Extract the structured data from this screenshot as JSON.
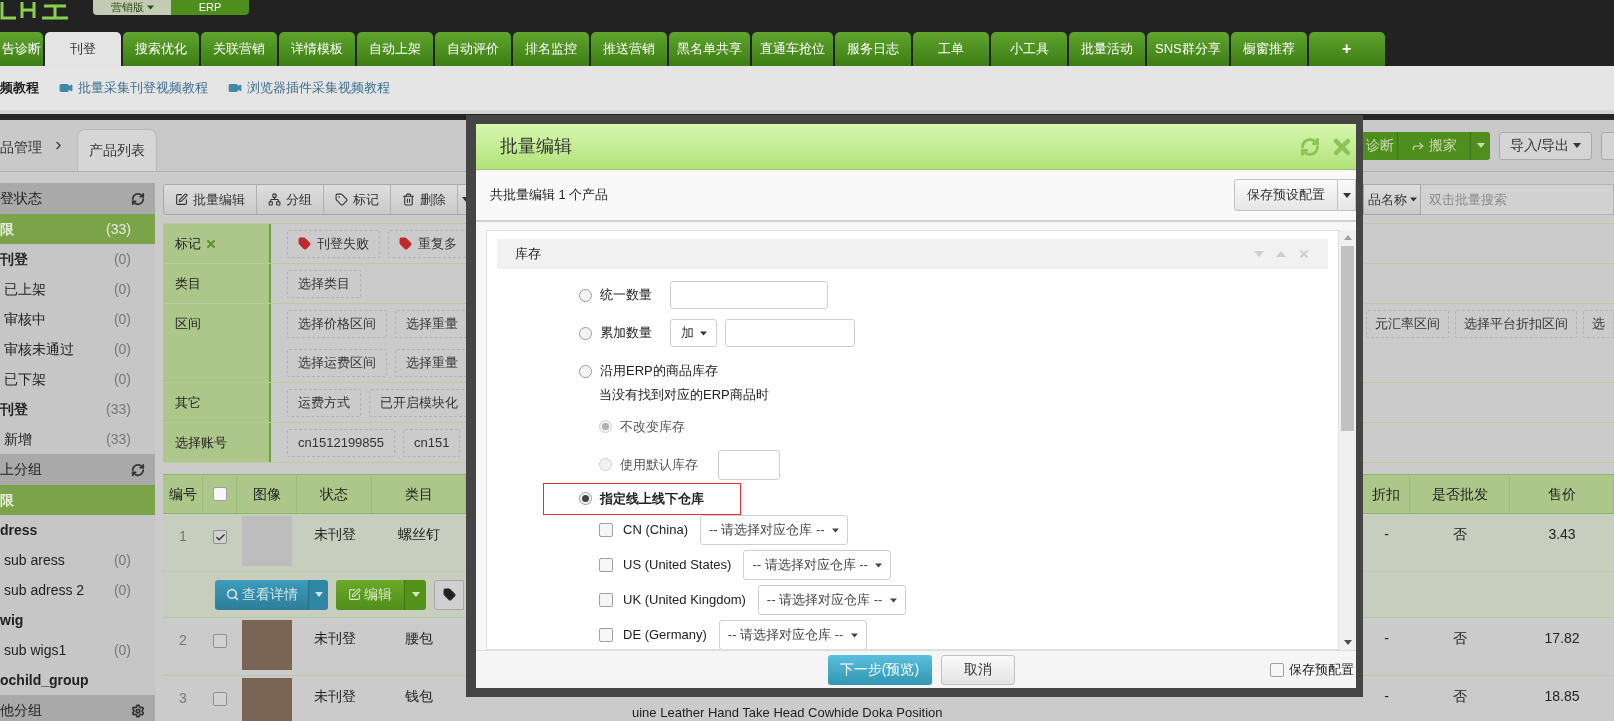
{
  "edition_switch": [
    {
      "label": "营销版",
      "selected": true
    },
    {
      "label": "ERP",
      "selected": false
    }
  ],
  "nav_tabs": [
    {
      "label": "告诊断",
      "selected": false
    },
    {
      "label": "刊登",
      "selected": true
    },
    {
      "label": "搜索优化",
      "selected": false
    },
    {
      "label": "关联营销",
      "selected": false
    },
    {
      "label": "详情模板",
      "selected": false
    },
    {
      "label": "自动上架",
      "selected": false
    },
    {
      "label": "自动评价",
      "selected": false
    },
    {
      "label": "排名监控",
      "selected": false
    },
    {
      "label": "推送营销",
      "selected": false
    },
    {
      "label": "黑名单共享",
      "selected": false
    },
    {
      "label": "直通车抢位",
      "selected": false
    },
    {
      "label": "服务日志",
      "selected": false
    },
    {
      "label": "工单",
      "selected": false
    },
    {
      "label": "小工具",
      "selected": false
    },
    {
      "label": "批量活动",
      "selected": false
    },
    {
      "label": "SNS群分享",
      "selected": false
    },
    {
      "label": "橱窗推荐",
      "selected": false
    },
    {
      "label": "+",
      "selected": false
    }
  ],
  "tutorials": [
    {
      "kind": "title",
      "label": "频教程"
    },
    {
      "kind": "video",
      "label": "批量采集刊登视频教程"
    },
    {
      "kind": "video",
      "label": "浏览器插件采集视频教程"
    }
  ],
  "breadcrumb": {
    "parent": "品管理",
    "current": "产品列表"
  },
  "top_actions": [
    {
      "kind": "partial",
      "label": "诊断"
    },
    {
      "kind": "split",
      "label": "搬家"
    },
    {
      "kind": "dropdown",
      "label": "导入/导出"
    },
    {
      "kind": "edge"
    }
  ],
  "toolbar": [
    {
      "kind": "edit",
      "label": "批量编辑"
    },
    {
      "kind": "group",
      "label": "分组"
    },
    {
      "kind": "tag",
      "label": "标记"
    },
    {
      "kind": "delete",
      "label": "删除"
    },
    {
      "kind": "more"
    }
  ],
  "search": {
    "field": "品名称",
    "placeholder": "双击批量搜索"
  },
  "sidebar": [
    {
      "title": "登状态",
      "kind": "refresh",
      "items": [
        {
          "label": "限",
          "count": "(33)",
          "selected": true
        },
        {
          "label": "刊登",
          "count": "(0)",
          "selected": false,
          "children": [
            {
              "label": "已上架",
              "count": "(0)",
              "selected": false
            },
            {
              "label": "审核中",
              "count": "(0)",
              "selected": false
            },
            {
              "label": "审核未通过",
              "count": "(0)",
              "selected": false
            },
            {
              "label": "已下架",
              "count": "(0)",
              "selected": false
            }
          ]
        },
        {
          "label": "刊登",
          "count": "(33)",
          "selected": false,
          "children": [
            {
              "label": "新增",
              "count": "(33)",
              "selected": false
            }
          ]
        }
      ]
    },
    {
      "title": "上分组",
      "kind": "refresh",
      "items": [
        {
          "label": "限",
          "selected": true
        },
        {
          "label": "dress",
          "selected": false,
          "children": [
            {
              "label": "sub aress",
              "count": "(0)",
              "selected": false
            },
            {
              "label": "sub adress 2",
              "count": "(0)",
              "selected": false
            }
          ]
        },
        {
          "label": "wig",
          "selected": false,
          "children": [
            {
              "label": "sub wigs1",
              "count": "(0)",
              "selected": false
            }
          ]
        },
        {
          "label": "ochild_group",
          "selected": false
        }
      ]
    },
    {
      "title": "他分组",
      "kind": "settings"
    }
  ],
  "filters": [
    {
      "label": "标记",
      "removable": true,
      "lines": [
        {
          "left": [
            {
              "kind": "tag",
              "label": "刊登失败"
            },
            {
              "kind": "tag",
              "label": "重复多"
            }
          ]
        }
      ]
    },
    {
      "label": "类目",
      "removable": false,
      "lines": [
        {
          "left": [
            {
              "kind": "plain",
              "label": "选择类目"
            }
          ]
        }
      ]
    },
    {
      "label": "区间",
      "removable": false,
      "lines": [
        {
          "left": [
            {
              "kind": "plain",
              "label": "选择价格区间"
            },
            {
              "kind": "plain",
              "label": "选择重量"
            }
          ],
          "right": [
            {
              "kind": "plain",
              "label": "元汇率区间"
            },
            {
              "kind": "plain",
              "label": "选择平台折扣区间"
            },
            {
              "kind": "plain",
              "label": "选"
            }
          ]
        },
        {
          "left": [
            {
              "kind": "plain",
              "label": "选择运费区间"
            },
            {
              "kind": "plain",
              "label": "选择重量"
            }
          ]
        }
      ]
    },
    {
      "label": "其它",
      "removable": false,
      "lines": [
        {
          "left": [
            {
              "kind": "plain",
              "label": "运费方式"
            },
            {
              "kind": "plain",
              "label": "已开启模块化"
            }
          ]
        }
      ]
    },
    {
      "label": "选择账号",
      "removable": false,
      "lines": [
        {
          "left": [
            {
              "kind": "plain",
              "label": "cn1512199855"
            },
            {
              "kind": "plain",
              "label": "cn151"
            }
          ]
        }
      ]
    }
  ],
  "product_table": {
    "left_columns": [
      {
        "kind": "text",
        "label": "编号"
      },
      {
        "kind": "checkbox",
        "checked": false
      },
      {
        "kind": "text",
        "label": "图像"
      },
      {
        "kind": "text",
        "label": "状态"
      },
      {
        "kind": "text",
        "label": "类目"
      }
    ],
    "right_columns": [
      "折扣",
      "是否批发",
      "售价"
    ],
    "rows": [
      {
        "number": "1",
        "checked": true,
        "selected": true,
        "status": "未刊登",
        "category": "螺丝钉",
        "discount": "-",
        "wholesale": "否",
        "price": "3.43",
        "actions": [
          {
            "kind": "view",
            "label": "查看详情"
          },
          {
            "kind": "edit",
            "label": "编辑"
          },
          {
            "kind": "tag"
          }
        ]
      },
      {
        "number": "2",
        "checked": false,
        "selected": false,
        "status": "未刊登",
        "category": "腰包",
        "discount": "-",
        "wholesale": "否",
        "price": "17.82"
      },
      {
        "number": "3",
        "checked": false,
        "selected": false,
        "status": "未刊登",
        "category": "钱包",
        "discount": "-",
        "wholesale": "否",
        "price": "18.85",
        "title": "uine Leather Hand Take Head Cowhide Doka Position"
      }
    ]
  },
  "dialog": {
    "title": "批量编辑",
    "summary": "共批量编辑 1 个产品",
    "preset_button": "保存预设配置",
    "section": {
      "title": "库存",
      "options": [
        {
          "kind": "input",
          "label": "统一数量",
          "selected": false,
          "highlighted": false
        },
        {
          "kind": "operator",
          "label": "累加数量",
          "operator": "加",
          "selected": false,
          "highlighted": false
        },
        {
          "kind": "erp",
          "label": "沿用ERP的商品库存",
          "selected": false,
          "highlighted": false,
          "note": "当没有找到对应的ERP商品时",
          "fallbacks": [
            {
              "label": "不改变库存",
              "selected": true,
              "disabled": true,
              "kind": "plain"
            },
            {
              "label": "使用默认库存",
              "selected": false,
              "disabled": true,
              "kind": "input"
            }
          ]
        },
        {
          "kind": "warehouse",
          "label": "指定线上线下仓库",
          "selected": true,
          "highlighted": true,
          "warehouses": [
            {
              "label": "CN (China)",
              "checked": false,
              "value": "-- 请选择对应仓库 --"
            },
            {
              "label": "US (United States)",
              "checked": false,
              "value": "-- 请选择对应仓库 --"
            },
            {
              "label": "UK (United Kingdom)",
              "checked": false,
              "value": "-- 请选择对应仓库 --"
            },
            {
              "label": "DE (Germany)",
              "checked": false,
              "value": "-- 请选择对应仓库 --"
            }
          ]
        }
      ]
    },
    "next_button": "下一步(预览)",
    "cancel_button": "取消",
    "save_preset": {
      "label": "保存预配置",
      "checked": false
    }
  }
}
